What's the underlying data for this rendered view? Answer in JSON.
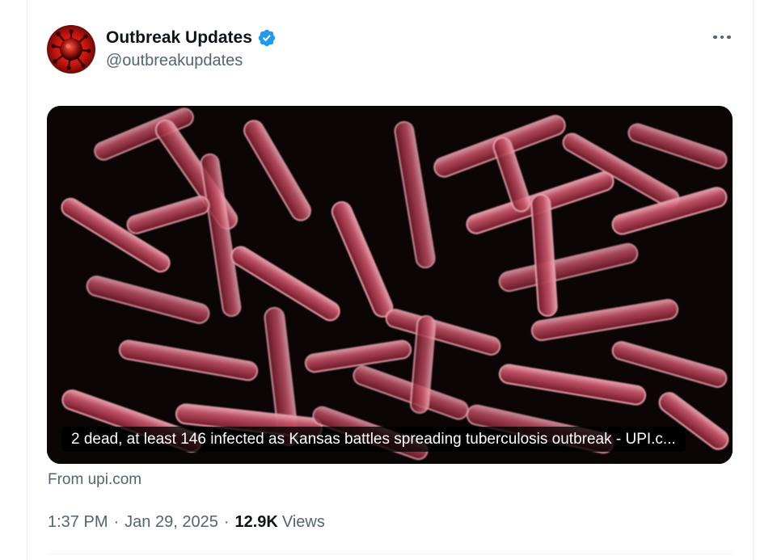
{
  "tweet": {
    "author": {
      "display_name": "Outbreak Updates",
      "handle": "@outbreakupdates",
      "verified": true,
      "avatar_icon": "virus-avatar-icon"
    },
    "menu_icon": "more-horizontal-icon",
    "card": {
      "headline": "2 dead, at least 146 infected as Kansas battles spreading tuberculosis outbreak - UPI.c...",
      "source": "From upi.com",
      "image": "bacteria-micrograph-image"
    },
    "time": "1:37 PM",
    "date": "Jan 29, 2025",
    "separator": "·",
    "views_count": "12.9K",
    "views_label": "Views"
  },
  "colors": {
    "text_primary": "#0f1419",
    "text_secondary": "#536471",
    "verified_blue": "#1d9bf0",
    "bacteria_pink": "#c0455a",
    "image_background": "#0c0506"
  }
}
